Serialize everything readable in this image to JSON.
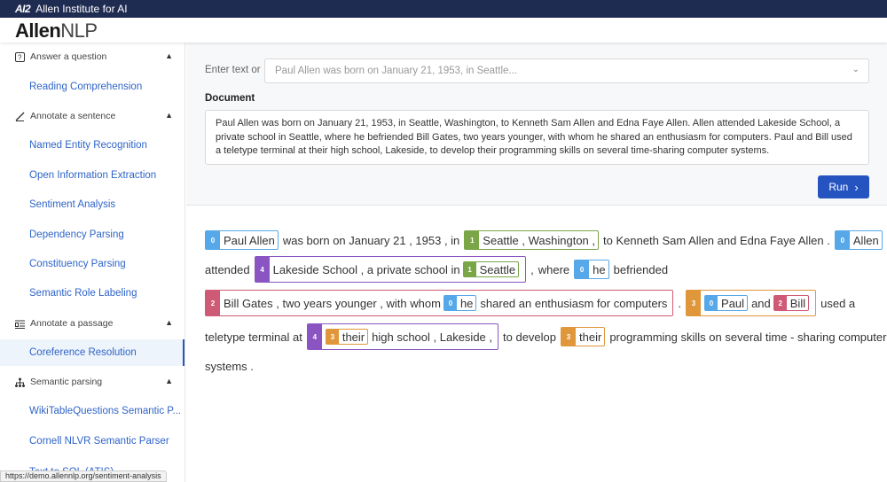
{
  "topbar": {
    "logo": "AI2",
    "org": "Allen Institute for AI"
  },
  "brand": {
    "bold": "Allen",
    "light": "NLP"
  },
  "sidebar": {
    "sections": [
      {
        "label": "Answer a question",
        "icon": "question-icon"
      },
      {
        "label": "Annotate a sentence",
        "icon": "pen-icon"
      },
      {
        "label": "Annotate a passage",
        "icon": "passage-icon"
      },
      {
        "label": "Semantic parsing",
        "icon": "tree-icon"
      }
    ],
    "items": [
      "Reading Comprehension",
      "Named Entity Recognition",
      "Open Information Extraction",
      "Sentiment Analysis",
      "Dependency Parsing",
      "Constituency Parsing",
      "Semantic Role Labeling",
      "Coreference Resolution",
      "WikiTableQuestions Semantic P...",
      "Cornell NLVR Semantic Parser",
      "Text to SQL (ATIS)"
    ],
    "active": "Coreference Resolution"
  },
  "status_url": "https://demo.allennlp.org/sentiment-analysis",
  "input": {
    "enter_label": "Enter text or",
    "select_placeholder": "Paul Allen was born on January 21, 1953, in Seattle...",
    "document_label": "Document",
    "document_text": "Paul Allen was born on January 21, 1953, in Seattle, Washington, to Kenneth Sam Allen and Edna Faye Allen. Allen attended Lakeside School, a private school in Seattle, where he befriended Bill Gates, two years younger, with whom he shared an enthusiasm for computers. Paul and Bill used a teletype terminal at their high school, Lakeside, to develop their programming skills on several time-sharing computer systems.",
    "run_label": "Run"
  },
  "colors": {
    "0": "#57a8e8",
    "1": "#7aa648",
    "2": "#cf5a76",
    "3": "#e0963a",
    "4": "#8a55c2"
  },
  "coref": {
    "l1": {
      "c0a": "Paul Allen",
      "w1": "was born on January 21 , 1953 , in",
      "c1a": "Seattle , Washington ,",
      "w2": "to Kenneth Sam Allen and Edna Faye Allen .",
      "c0b": "Allen"
    },
    "l2": {
      "w1": "attended",
      "c4a": "Lakeside School , a private school in",
      "c1b": "Seattle",
      "w2": ",",
      "w3": "where",
      "c0c": "he",
      "w4": "befriended"
    },
    "l3": {
      "c2a": "Bill Gates , two years younger , with whom",
      "c0d": "he",
      "c2a_tail": "shared an enthusiasm for computers",
      "w1": ".",
      "c0e": "Paul",
      "and": "and",
      "c2b": "Bill",
      "w2": "used a"
    },
    "l4": {
      "w1": "teletype terminal at",
      "c3a": "their",
      "c4b_tail": "high school , Lakeside ,",
      "w2": "to develop",
      "c3b": "their",
      "w3": "programming skills on several time - sharing computer"
    },
    "l5": {
      "w1": "systems ."
    },
    "labels": {
      "zero": "0",
      "one": "1",
      "two": "2",
      "three": "3",
      "four": "4"
    }
  }
}
